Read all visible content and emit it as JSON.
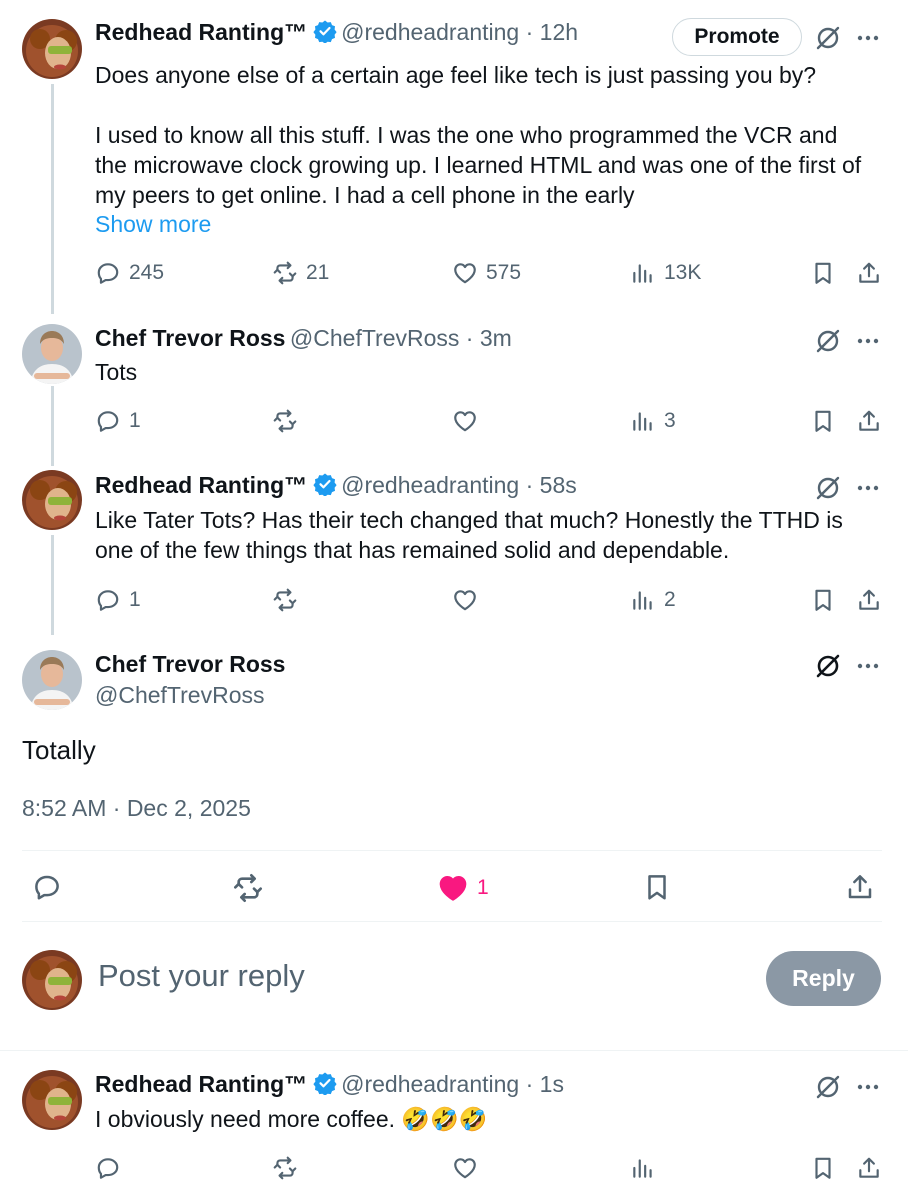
{
  "thread": {
    "tweet1": {
      "name": "Redhead Ranting™",
      "handle": "@redheadranting · 12h",
      "promote_label": "Promote",
      "text_line1": "Does anyone else of a certain age feel like tech is just passing you by?",
      "text_line2": "I used to know all this stuff. I was the one who programmed the VCR and",
      "text_line3": "the microwave clock growing up. I learned HTML and was one of the first of",
      "text_line4": "my peers to get online. I had a cell phone in the early",
      "show_more": "Show more",
      "replies": "245",
      "reposts": "21",
      "likes": "575",
      "views": "13K"
    },
    "tweet2": {
      "name": "Chef Trevor Ross",
      "handle": "@ChefTrevRoss · 3m",
      "text": "Tots",
      "replies": "1",
      "views": "3"
    },
    "tweet3": {
      "name": "Redhead Ranting™",
      "handle": "@redheadranting · 58s",
      "text_line1": "Like Tater Tots? Has their tech changed that much? Honestly the TTHD is",
      "text_line2": "one of the few things that has remained solid and dependable.",
      "replies": "1",
      "views": "2"
    },
    "focus": {
      "name": "Chef Trevor Ross",
      "handle": "@ChefTrevRoss",
      "text": "Totally",
      "timestamp": "8:52 AM · Dec 2, 2025",
      "likes": "1"
    },
    "composer": {
      "placeholder": "Post your reply",
      "button": "Reply"
    },
    "tweet4": {
      "name": "Redhead Ranting™",
      "handle": "@redheadranting · 1s",
      "text": "I obviously need more coffee. 🤣🤣🤣"
    }
  },
  "colors": {
    "text": "#0f1419",
    "secondary": "#536471",
    "link": "#1d9bf0",
    "like_active": "#f91880",
    "verified": "#1d9bf0",
    "reply_button": "#8b98a5"
  },
  "icons": [
    "verified-badge-icon",
    "grok-icon",
    "more-icon",
    "reply-icon",
    "repost-icon",
    "like-icon",
    "views-icon",
    "bookmark-icon",
    "share-icon"
  ]
}
